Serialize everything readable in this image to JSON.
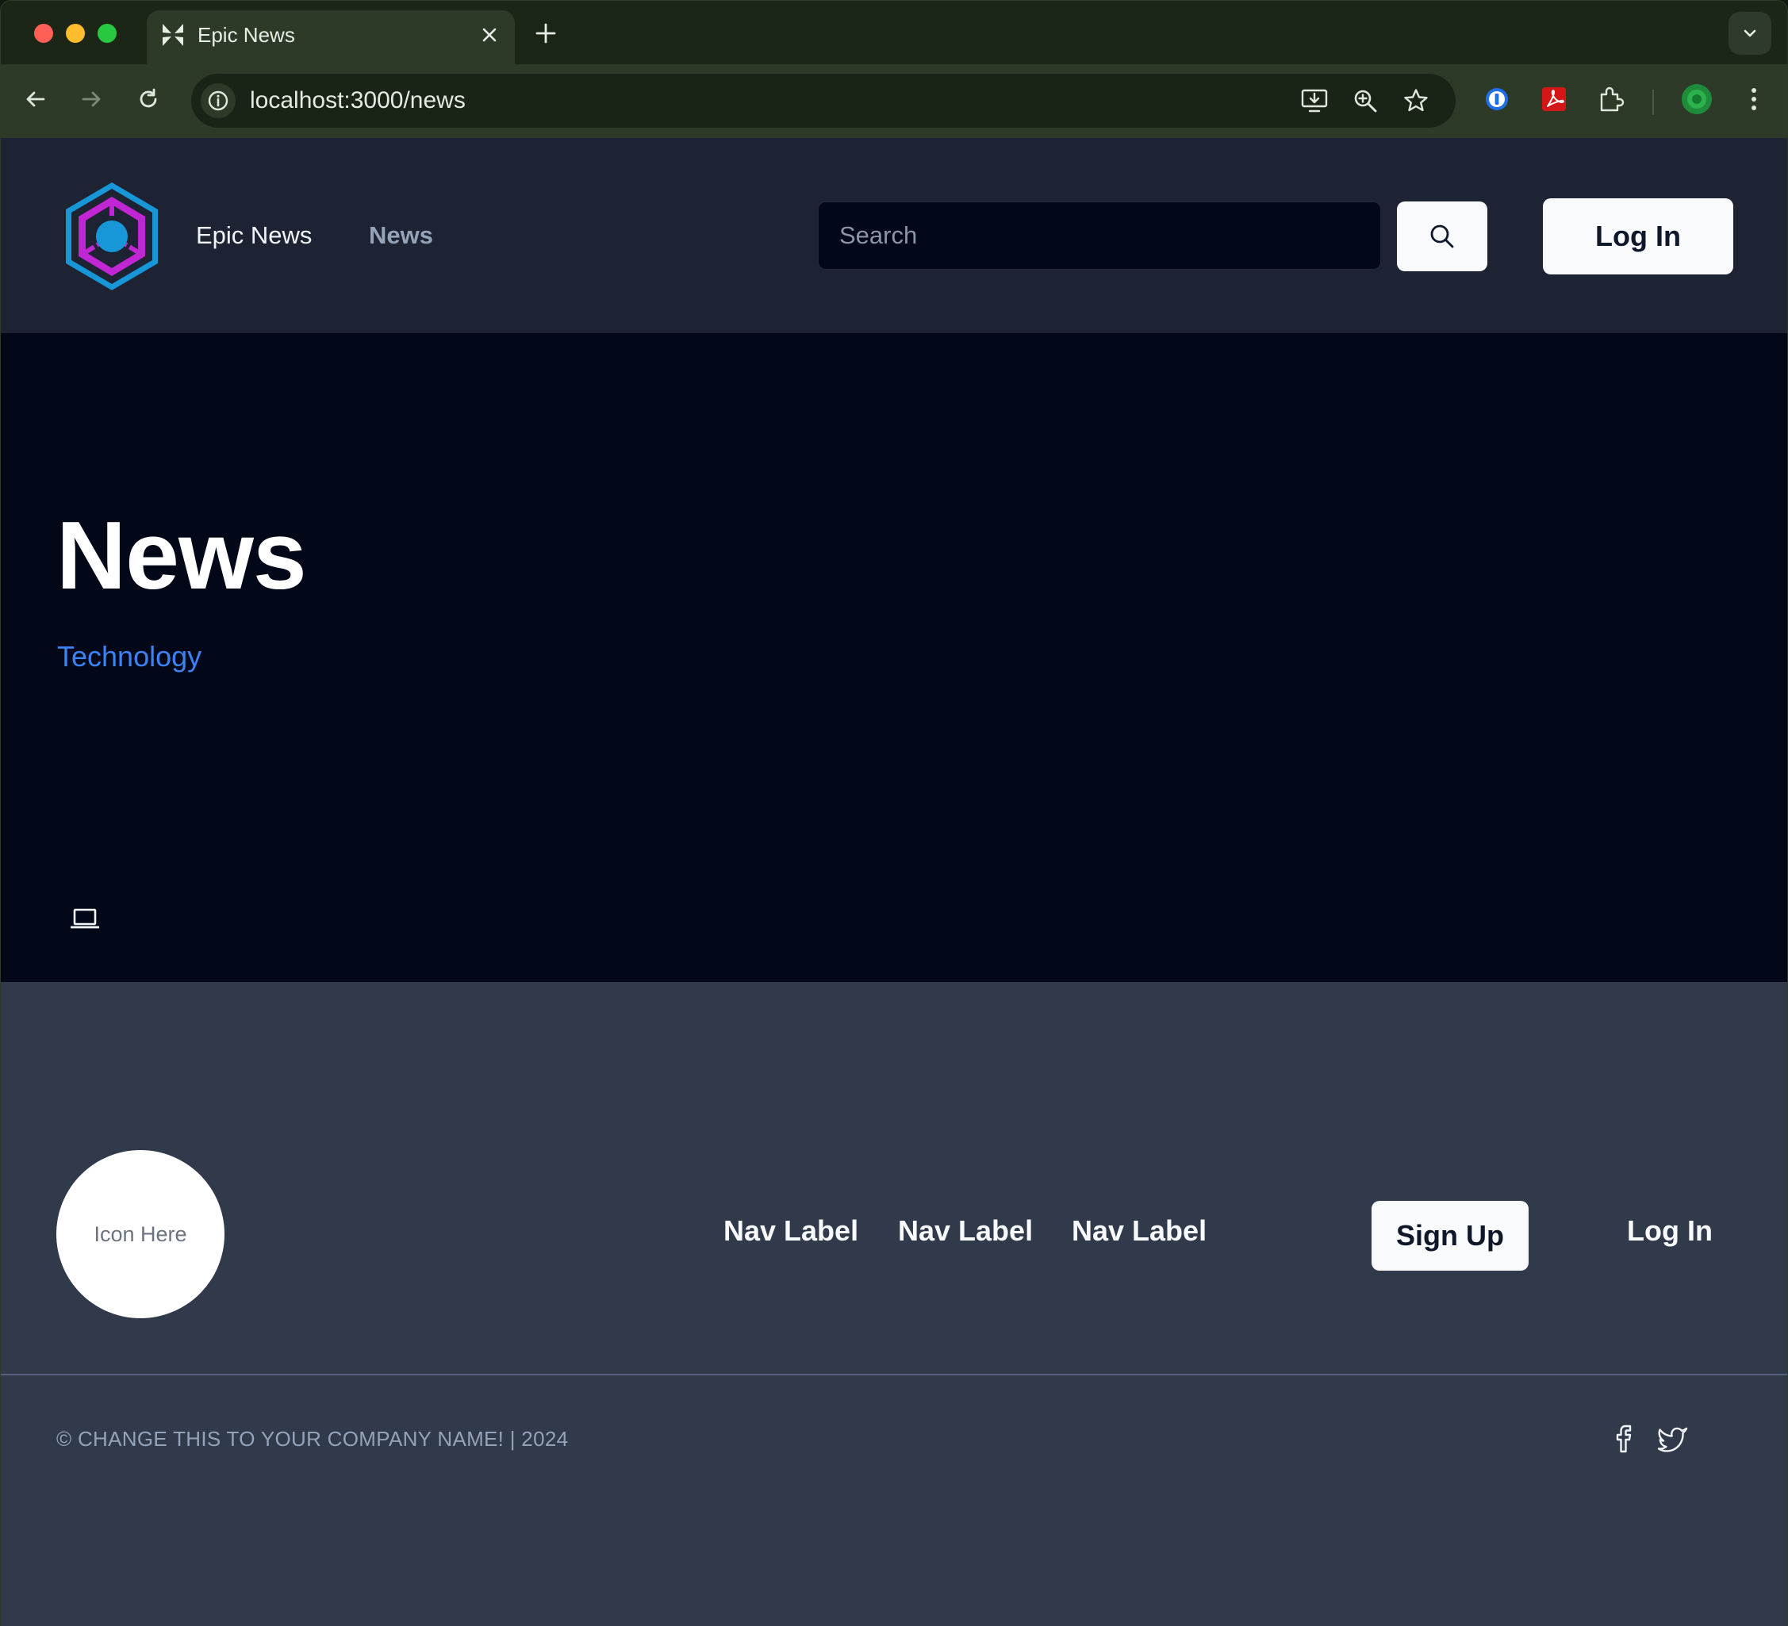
{
  "browser": {
    "tab_title": "Epic News",
    "url": "localhost:3000/news",
    "icons": [
      "favicon-icon",
      "close-icon",
      "new-tab-icon",
      "tab-search-icon",
      "back-icon",
      "forward-icon",
      "reload-icon",
      "site-info-icon",
      "install-app-icon",
      "zoom-icon",
      "bookmark-star-icon",
      "password-manager-icon",
      "pdf-extension-icon",
      "extensions-puzzle-icon",
      "profile-avatar",
      "kebab-menu-icon"
    ]
  },
  "header": {
    "brand": "Epic News",
    "nav": [
      "News"
    ],
    "search_placeholder": "Search",
    "login_label": "Log In",
    "logo_colors": {
      "outer": "#1796d8",
      "inner": "#c026d3",
      "core": "#1796d8"
    }
  },
  "main": {
    "title": "News",
    "category": "Technology",
    "icon": "laptop-icon"
  },
  "footer": {
    "icon_placeholder": "Icon Here",
    "nav": [
      "Nav Label",
      "Nav Label",
      "Nav Label"
    ],
    "signup_label": "Sign Up",
    "login_label": "Log In",
    "copyright": "© CHANGE THIS TO YOUR COMPANY NAME! | 2024",
    "social": [
      "facebook-icon",
      "twitter-icon"
    ]
  },
  "colors": {
    "header_bg": "#1d2333",
    "main_bg": "#020817",
    "footer_bg": "#313a4b",
    "link_blue": "#3b82f6"
  }
}
